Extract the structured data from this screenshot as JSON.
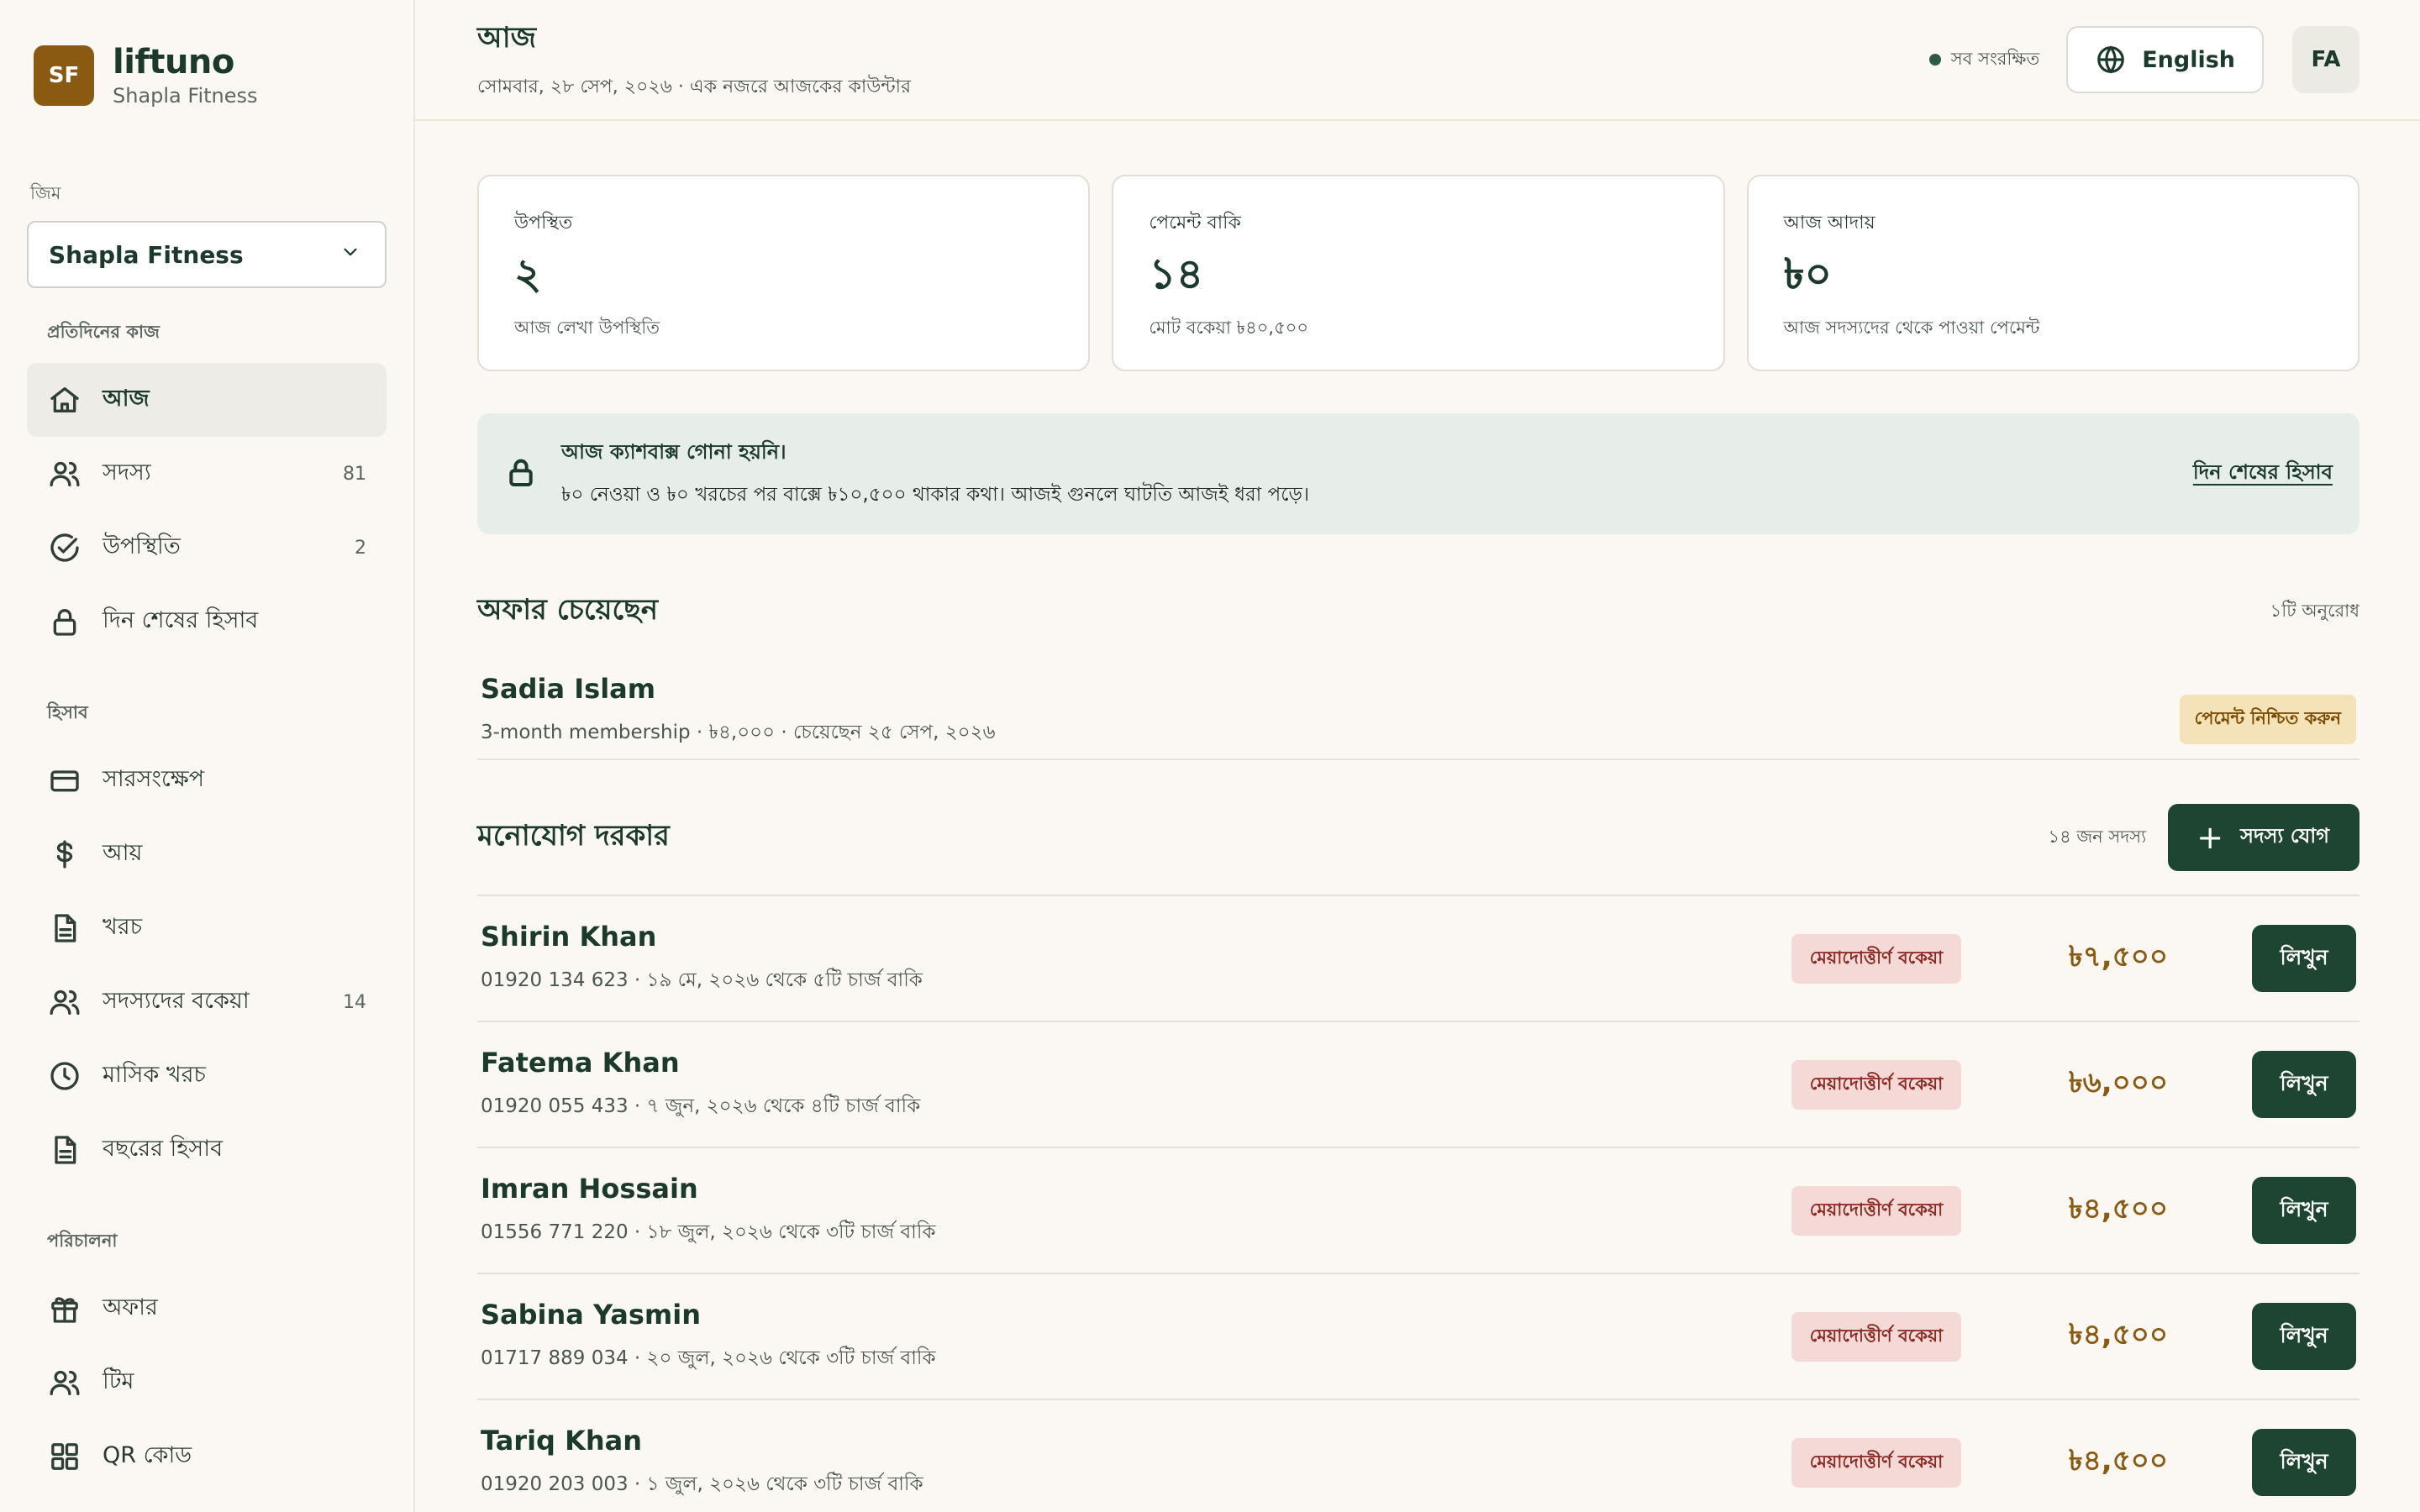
{
  "brand": {
    "logo_initials": "SF",
    "name": "liftuno",
    "gym_name": "Shapla Fitness"
  },
  "sidebar": {
    "gym_label": "জিম",
    "gym_select": "Shapla Fitness",
    "sections": [
      {
        "label": "প্রতিদিনের কাজ",
        "items": [
          {
            "label": "আজ",
            "icon": "home-icon",
            "count": "",
            "active": true
          },
          {
            "label": "সদস্য",
            "icon": "users-icon",
            "count": "81"
          },
          {
            "label": "উপস্থিতি",
            "icon": "check-circle-icon",
            "count": "2"
          },
          {
            "label": "দিন শেষের হিসাব",
            "icon": "lock-icon",
            "count": ""
          }
        ]
      },
      {
        "label": "হিসাব",
        "items": [
          {
            "label": "সারসংক্ষেপ",
            "icon": "credit-card-icon",
            "count": ""
          },
          {
            "label": "আয়",
            "icon": "dollar-icon",
            "count": ""
          },
          {
            "label": "খরচ",
            "icon": "document-icon",
            "count": ""
          },
          {
            "label": "সদস্যদের বকেয়া",
            "icon": "users-icon",
            "count": "14"
          },
          {
            "label": "মাসিক খরচ",
            "icon": "clock-icon",
            "count": ""
          },
          {
            "label": "বছরের হিসাব",
            "icon": "document-icon",
            "count": ""
          }
        ]
      },
      {
        "label": "পরিচালনা",
        "items": [
          {
            "label": "অফার",
            "icon": "gift-icon",
            "count": ""
          },
          {
            "label": "টিম",
            "icon": "users-icon",
            "count": ""
          },
          {
            "label": "QR কোড",
            "icon": "grid-icon",
            "count": ""
          }
        ]
      }
    ]
  },
  "header": {
    "title": "আজ",
    "subtitle": "সোমবার, ২৮ সেপ, ২০২৬ · এক নজরে আজকের কাউন্টার",
    "saved_status": "সব সংরক্ষিত",
    "language_button": "English",
    "avatar_initials": "FA"
  },
  "stats": [
    {
      "label": "উপস্থিত",
      "value": "২",
      "note": "আজ লেখা উপস্থিতি"
    },
    {
      "label": "পেমেন্ট বাকি",
      "value": "১৪",
      "note": "মোট বকেয়া ৳৪০,৫০০"
    },
    {
      "label": "আজ আদায়",
      "value": "৳০",
      "note": "আজ সদস্যদের থেকে পাওয়া পেমেন্ট"
    }
  ],
  "alert": {
    "title": "আজ ক্যাশবাক্স গোনা হয়নি।",
    "body": "৳০ নেওয়া ও ৳০ খরচের পর বাক্সে ৳১০,৫০০ থাকার কথা। আজই গুনলে ঘাটতি আজই ধরা পড়ে।",
    "link": "দিন শেষের হিসাব"
  },
  "offers": {
    "title": "অফার চেয়েছেন",
    "meta": "১টি অনুরোধ",
    "items": [
      {
        "name": "Sadia Islam",
        "detail": "3-month membership · ৳৪,০০০ · চেয়েছেন ২৫ সেপ, ২০২৬",
        "badge": "পেমেন্ট নিশ্চিত করুন"
      }
    ]
  },
  "attention": {
    "title": "মনোযোগ দরকার",
    "meta": "১৪ জন সদস্য",
    "add_button": "সদস্য যোগ",
    "members": [
      {
        "name": "Shirin Khan",
        "detail": "01920 134 623 · ১৯ মে, ২০২৬ থেকে ৫টি চার্জ বাকি",
        "badge": "মেয়াদোত্তীর্ণ বকেয়া",
        "amount": "৳৭,৫০০",
        "action": "লিখুন"
      },
      {
        "name": "Fatema Khan",
        "detail": "01920 055 433 · ৭ জুন, ২০২৬ থেকে ৪টি চার্জ বাকি",
        "badge": "মেয়াদোত্তীর্ণ বকেয়া",
        "amount": "৳৬,০০০",
        "action": "লিখুন"
      },
      {
        "name": "Imran Hossain",
        "detail": "01556 771 220 · ১৮ জুল, ২০২৬ থেকে ৩টি চার্জ বাকি",
        "badge": "মেয়াদোত্তীর্ণ বকেয়া",
        "amount": "৳৪,৫০০",
        "action": "লিখুন"
      },
      {
        "name": "Sabina Yasmin",
        "detail": "01717 889 034 · ২০ জুল, ২০২৬ থেকে ৩টি চার্জ বাকি",
        "badge": "মেয়াদোত্তীর্ণ বকেয়া",
        "amount": "৳৪,৫০০",
        "action": "লিখুন"
      },
      {
        "name": "Tariq Khan",
        "detail": "01920 203 003 · ১ জুল, ২০২৬ থেকে ৩টি চার্জ বাকি",
        "badge": "মেয়াদোত্তীর্ণ বকেয়া",
        "amount": "৳৪,৫০০",
        "action": "লিখুন"
      }
    ]
  }
}
